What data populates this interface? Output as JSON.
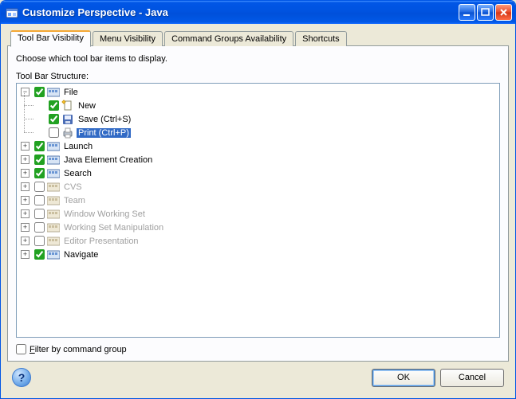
{
  "window": {
    "title": "Customize Perspective - Java"
  },
  "tabs": {
    "items": [
      {
        "label": "Tool Bar Visibility",
        "active": true
      },
      {
        "label": "Menu Visibility",
        "active": false
      },
      {
        "label": "Command Groups Availability",
        "active": false
      },
      {
        "label": "Shortcuts",
        "active": false
      }
    ]
  },
  "panel": {
    "hint": "Choose which tool bar items to display.",
    "structure_label": "Tool Bar Structure:",
    "filter_prefix": "F",
    "filter_rest": "ilter by command group"
  },
  "tree": {
    "root": {
      "label": "File",
      "checked": true,
      "children": [
        {
          "label": "New",
          "checked": true,
          "icon": "new"
        },
        {
          "label": "Save (Ctrl+S)",
          "checked": true,
          "icon": "save"
        },
        {
          "label": "Print (Ctrl+P)",
          "checked": false,
          "icon": "print",
          "selected": true
        }
      ]
    },
    "collapsed": [
      {
        "label": "Launch",
        "checked": true,
        "enabled": true
      },
      {
        "label": "Java Element Creation",
        "checked": true,
        "enabled": true
      },
      {
        "label": "Search",
        "checked": true,
        "enabled": true
      },
      {
        "label": "CVS",
        "checked": false,
        "enabled": false
      },
      {
        "label": "Team",
        "checked": false,
        "enabled": false
      },
      {
        "label": "Window Working Set",
        "checked": false,
        "enabled": false
      },
      {
        "label": "Working Set Manipulation",
        "checked": false,
        "enabled": false
      },
      {
        "label": "Editor Presentation",
        "checked": false,
        "enabled": false
      },
      {
        "label": "Navigate",
        "checked": true,
        "enabled": true
      }
    ]
  },
  "footer": {
    "ok": "OK",
    "cancel": "Cancel"
  }
}
